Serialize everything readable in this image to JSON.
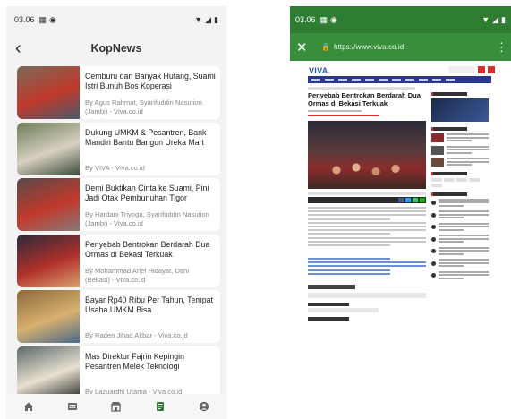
{
  "left": {
    "status": {
      "time": "03.06"
    },
    "app": {
      "title": "KopNews"
    },
    "articles": [
      {
        "title": "Cemburu dan Banyak Hutang, Suami Istri Bunuh Bos Koperasi",
        "meta": "By Agus Rahmat, Syarifuddin Nasution (Jambi) - Viva.co.id",
        "thumb_colors": [
          "#7a6a5a",
          "#c0392b",
          "#4a5a6a"
        ]
      },
      {
        "title": "Dukung UMKM & Pesantren, Bank Mandiri Bantu Bangun Ureka Mart",
        "meta": "By VIVA - Viva.co.id",
        "thumb_colors": [
          "#6b7d5a",
          "#d8d0c0",
          "#3c4a3a"
        ]
      },
      {
        "title": "Demi Buktikan Cinta ke Suami, Pini Jadi Otak Pembunuhan Tigor",
        "meta": "By Hardani Triyoga, Syarifuddin Nasution (Jambi) - Viva.co.id",
        "thumb_colors": [
          "#5a4a4a",
          "#c0392b",
          "#8a7a7a"
        ]
      },
      {
        "title": "Penyebab Bentrokan Berdarah Dua Ormas di Bekasi Terkuak",
        "meta": "By Mohammad Arief Hidayat, Dani (Bekasi) - Viva.co.id",
        "thumb_colors": [
          "#2a2a3a",
          "#b0302a",
          "#d8a070"
        ]
      },
      {
        "title": "Bayar Rp40 Ribu Per Tahun, Tempat Usaha UMKM Bisa",
        "meta": "By Raden Jihad Akbar - Viva.co.id",
        "thumb_colors": [
          "#8a6a3a",
          "#d8b070",
          "#4a6a8a"
        ]
      },
      {
        "title": "Mas Direktur Fajrin Kepingin Pesantren Melek Teknologi",
        "meta": "By Lazuardhi Utama - Viva.co.id",
        "thumb_colors": [
          "#5a6a6a",
          "#e8e0d0",
          "#2a2a2a"
        ]
      }
    ],
    "tabs": [
      "home-icon",
      "news-icon",
      "store-icon",
      "article-icon",
      "profile-icon"
    ]
  },
  "right": {
    "status": {
      "time": "03.06"
    },
    "browser": {
      "url": "https://www.viva.co.id"
    },
    "page": {
      "logo_main": "VIVA",
      "logo_dot": ".",
      "headline": "Penyebab Bentrokan Berdarah Dua Ormas di Bekasi Terkuak"
    },
    "colors": {
      "status_bar": "#2e7d32",
      "toolbar": "#388e3c",
      "nav": "#283593",
      "accent": "#d32f2f"
    }
  }
}
